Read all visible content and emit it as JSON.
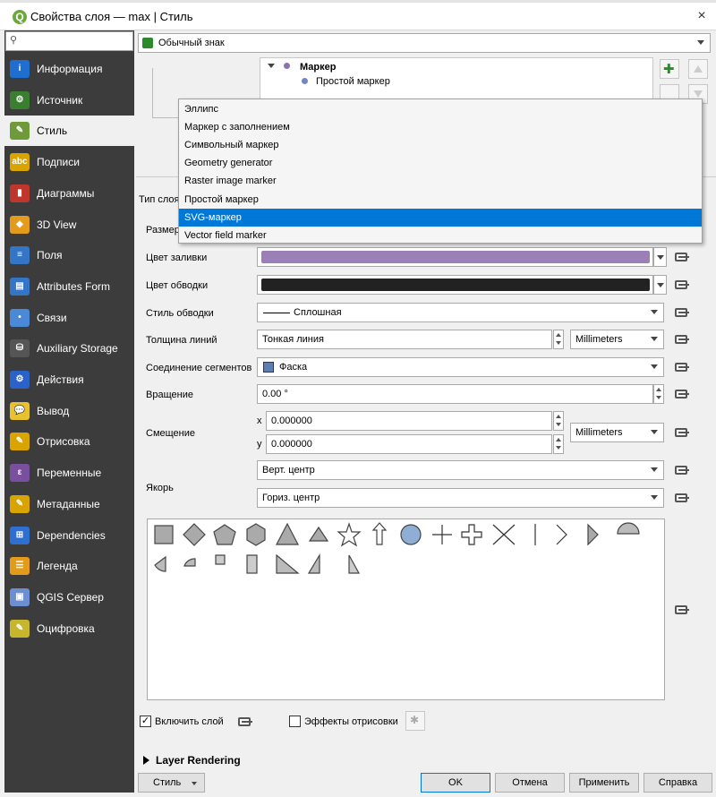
{
  "window": {
    "title": "Свойства слоя — max | Стиль",
    "close": "×"
  },
  "sidebar": {
    "search_placeholder": "",
    "items": [
      {
        "label": "Информация",
        "icon": "info-icon",
        "icon_text": "i"
      },
      {
        "label": "Источник",
        "icon": "source-icon",
        "icon_text": "⚙"
      },
      {
        "label": "Стиль",
        "icon": "paintbrush-icon",
        "icon_text": "✎"
      },
      {
        "label": "Подписи",
        "icon": "labels-icon",
        "icon_text": "abc"
      },
      {
        "label": "Диаграммы",
        "icon": "diagrams-icon",
        "icon_text": "▮"
      },
      {
        "label": "3D View",
        "icon": "cube-icon",
        "icon_text": "◆"
      },
      {
        "label": "Поля",
        "icon": "fields-icon",
        "icon_text": "≡"
      },
      {
        "label": "Attributes Form",
        "icon": "form-icon",
        "icon_text": "▤"
      },
      {
        "label": "Связи",
        "icon": "relations-icon",
        "icon_text": "•"
      },
      {
        "label": "Auxiliary Storage",
        "icon": "storage-icon",
        "icon_text": "⛁"
      },
      {
        "label": "Действия",
        "icon": "actions-icon",
        "icon_text": "⚙"
      },
      {
        "label": "Вывод",
        "icon": "display-icon",
        "icon_text": "💬"
      },
      {
        "label": "Отрисовка",
        "icon": "rendering-icon",
        "icon_text": "✎"
      },
      {
        "label": "Переменные",
        "icon": "variables-icon",
        "icon_text": "ε"
      },
      {
        "label": "Метаданные",
        "icon": "metadata-icon",
        "icon_text": "✎"
      },
      {
        "label": "Dependencies",
        "icon": "dependencies-icon",
        "icon_text": "⊞"
      },
      {
        "label": "Легенда",
        "icon": "legend-icon",
        "icon_text": "☰"
      },
      {
        "label": "QGIS Сервер",
        "icon": "server-icon",
        "icon_text": "▣"
      },
      {
        "label": "Оцифровка",
        "icon": "digitizing-icon",
        "icon_text": "✎"
      }
    ]
  },
  "renderer": {
    "value": "Обычный знак"
  },
  "tree": {
    "root": "Маркер",
    "child": "Простой маркер"
  },
  "popup": {
    "items": [
      "Эллипс",
      "Маркер с заполнением",
      "Символьный маркер",
      "Geometry generator",
      "Raster image marker",
      "Простой маркер",
      "SVG-маркер",
      "Vector field marker"
    ],
    "highlighted": 6
  },
  "form": {
    "type_label": "Тип слоя",
    "size_label": "Размер",
    "fill_label": "Цвет заливки",
    "fill_color": "#9b7fb7",
    "stroke_label": "Цвет обводки",
    "stroke_color": "#222222",
    "stroke_style_label": "Стиль обводки",
    "stroke_style_value": "Сплошная",
    "width_label": "Толщина линий",
    "width_value": "Тонкая линия",
    "width_unit": "Millimeters",
    "join_label": "Соединение сегментов",
    "join_value": "Фаска",
    "rotation_label": "Вращение",
    "rotation_value": "0.00 °",
    "offset_label": "Смещение",
    "offset_x_label": "x",
    "offset_x_value": "0.000000",
    "offset_y_label": "y",
    "offset_y_value": "0.000000",
    "offset_unit": "Millimeters",
    "anchor_label": "Якорь",
    "anchor_v": "Верт. центр",
    "anchor_h": "Гориз. центр"
  },
  "footer": {
    "enable_layer": "Включить слой",
    "draw_effects": "Эффекты отрисовки",
    "layer_rendering": "Layer Rendering",
    "style_button": "Стиль",
    "ok": "OK",
    "cancel": "Отмена",
    "apply": "Применить",
    "help": "Справка"
  },
  "colors": {
    "sidebar_bg": "#3c3c3c",
    "highlight": "#0078d7"
  }
}
